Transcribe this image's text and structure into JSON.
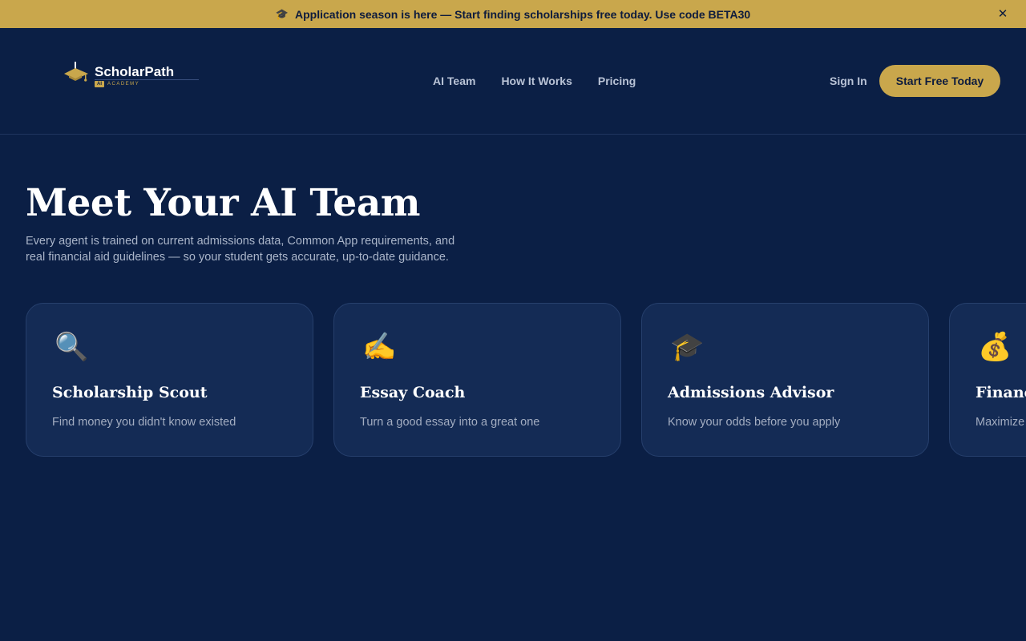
{
  "announcement": {
    "icon": "graduation-cap-icon",
    "text": "Application season is here — Start finding scholarships free today. Use code BETA30",
    "close_icon": "close-icon"
  },
  "header": {
    "brand": "ScholarPath",
    "badge": "AI",
    "subbrand": "ACADEMY",
    "nav": [
      "AI Team",
      "How It Works",
      "Pricing"
    ],
    "sign_in": "Sign In",
    "cta": "Start Free Today"
  },
  "hero": {
    "title": "Meet Your AI Team",
    "description_line1": "Every agent is trained on current admissions data, Common App requirements, and",
    "description_line2": "real financial aid guidelines — so your student gets accurate, up-to-date guidance."
  },
  "cards": [
    {
      "emoji": "🔍",
      "icon": "magnifying-glass-icon",
      "title": "Scholarship Scout",
      "desc": "Find money you didn't know existed"
    },
    {
      "emoji": "✍️",
      "icon": "writing-hand-icon",
      "title": "Essay Coach",
      "desc": "Turn a good essay into a great one"
    },
    {
      "emoji": "🎓",
      "icon": "graduation-cap-icon",
      "title": "Admissions Advisor",
      "desc": "Know your odds before you apply"
    },
    {
      "emoji": "💰",
      "icon": "money-bag-icon",
      "title": "Financ",
      "desc": "Maximize"
    }
  ],
  "colors": {
    "background": "#0b1f45",
    "gold": "#c9a74c",
    "card": "#142b55"
  }
}
